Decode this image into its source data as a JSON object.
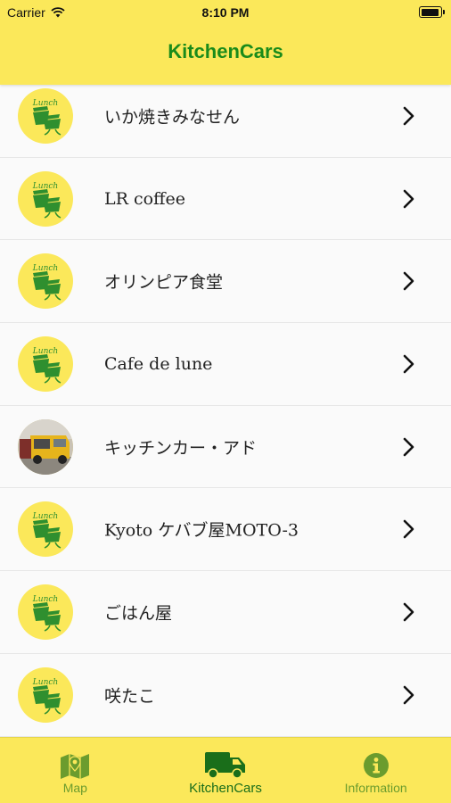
{
  "status_bar": {
    "carrier": "Carrier",
    "time": "8:10 PM",
    "battery_level": 0.95
  },
  "header": {
    "title": "KitchenCars"
  },
  "list": {
    "items": [
      {
        "name": "いか焼きみなせん",
        "thumbnail": "lunch-logo-icon"
      },
      {
        "name": "LR coffee",
        "thumbnail": "lunch-logo-icon"
      },
      {
        "name": "オリンピア食堂",
        "thumbnail": "lunch-logo-icon"
      },
      {
        "name": "Cafe de lune",
        "thumbnail": "lunch-logo-icon"
      },
      {
        "name": "キッチンカー・アド",
        "thumbnail": "truck-photo"
      },
      {
        "name": "Kyoto ケバブ屋MOTO-3",
        "thumbnail": "lunch-logo-icon"
      },
      {
        "name": "ごはん屋",
        "thumbnail": "lunch-logo-icon"
      },
      {
        "name": "咲たこ",
        "thumbnail": "lunch-logo-icon"
      }
    ]
  },
  "tabbar": {
    "tabs": [
      {
        "label": "Map",
        "icon": "map-icon",
        "active": false
      },
      {
        "label": "KitchenCars",
        "icon": "truck-icon",
        "active": true
      },
      {
        "label": "Information",
        "icon": "info-icon",
        "active": false
      }
    ]
  },
  "colors": {
    "header_bg": "#fbe85a",
    "title": "#1a8b1a",
    "tab_active": "#1a6e1a",
    "tab_inactive": "#6b9c2e"
  }
}
